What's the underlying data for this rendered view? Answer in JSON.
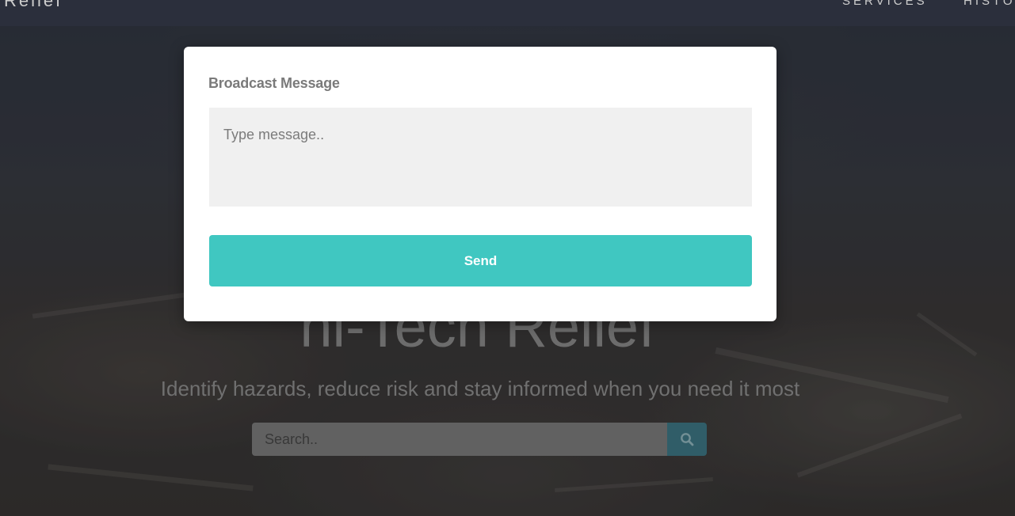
{
  "navbar": {
    "brand": "i Relief",
    "links": [
      "SERVICES",
      "HISTO"
    ]
  },
  "hero": {
    "title": "hi-Tech Relief",
    "tagline": "Identify hazards, reduce risk and stay informed when you need it most",
    "search": {
      "placeholder": "Search.."
    }
  },
  "modal": {
    "label": "Broadcast Message",
    "message_placeholder": "Type message..",
    "send_label": "Send"
  },
  "colors": {
    "accent": "#40c7c1",
    "search_button": "#3d7582",
    "navbar": "#363b4b"
  },
  "icons": {
    "search_button": "search-icon"
  }
}
